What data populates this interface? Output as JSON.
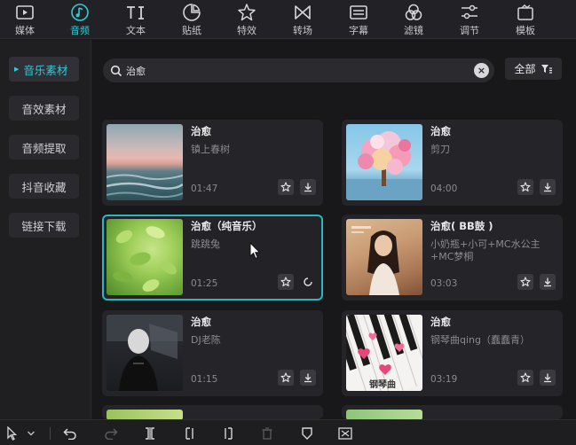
{
  "topbar": {
    "tools": [
      {
        "label": "媒体",
        "icon": "media-icon"
      },
      {
        "label": "音频",
        "icon": "audio-icon"
      },
      {
        "label": "文本",
        "icon": "text-icon"
      },
      {
        "label": "贴纸",
        "icon": "sticker-icon"
      },
      {
        "label": "特效",
        "icon": "effects-icon"
      },
      {
        "label": "转场",
        "icon": "transition-icon"
      },
      {
        "label": "字幕",
        "icon": "subtitle-icon"
      },
      {
        "label": "滤镜",
        "icon": "filter-icon"
      },
      {
        "label": "调节",
        "icon": "adjust-icon"
      },
      {
        "label": "模板",
        "icon": "template-icon"
      }
    ],
    "active_index": 1,
    "accent": "#2ecbd6"
  },
  "sidebar": {
    "items": [
      {
        "label": "音乐素材"
      },
      {
        "label": "音效素材"
      },
      {
        "label": "音频提取"
      },
      {
        "label": "抖音收藏"
      },
      {
        "label": "链接下载"
      }
    ],
    "active_index": 0
  },
  "search": {
    "value": "治愈",
    "placeholder": ""
  },
  "filter": {
    "label": "全部"
  },
  "tracks": [
    {
      "title": "治愈",
      "artist": "镇上春树",
      "duration": "01:47"
    },
    {
      "title": "治愈",
      "artist": "剪刀",
      "duration": "04:00"
    },
    {
      "title": "治愈（纯音乐）",
      "artist": "跳跳兔",
      "duration": "01:25"
    },
    {
      "title": "治愈( BB鼓 )",
      "artist": "小奶瓶+小可+MC水公主+MC梦桐",
      "duration": "03:03"
    },
    {
      "title": "治愈",
      "artist": "DJ老陈",
      "duration": "01:15"
    },
    {
      "title": "治愈",
      "artist": "钢琴曲qing（蠢蠢青）",
      "duration": "03:19"
    }
  ],
  "thumb_text": {
    "piano_caption": "钢琴曲"
  },
  "colors": {
    "accent": "#2ecbd6",
    "selected_border": "#2bb7c0",
    "card_bg": "#252529"
  }
}
